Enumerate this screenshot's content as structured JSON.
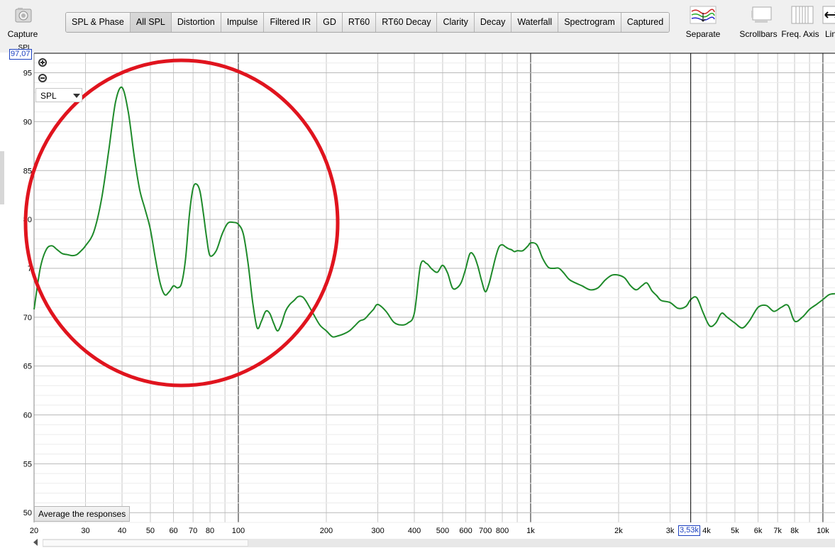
{
  "toolbar": {
    "capture_label": "Capture",
    "tabs": [
      "SPL & Phase",
      "All SPL",
      "Distortion",
      "Impulse",
      "Filtered IR",
      "GD",
      "RT60",
      "RT60 Decay",
      "Clarity",
      "Decay",
      "Waterfall",
      "Spectrogram",
      "Captured"
    ],
    "active_tab": "All SPL",
    "separate_label": "Separate",
    "scrollbars_label": "Scrollbars",
    "freq_axis_label": "Freq. Axis",
    "lin_label": "Lin"
  },
  "plot": {
    "y_axis_title": "SPL",
    "y_readout": "97,07",
    "x_readout": "3,53k",
    "spl_select_value": "SPL",
    "average_button_label": "Average the responses"
  },
  "chart_data": {
    "type": "line",
    "x_scale": "log",
    "xlim": [
      20,
      11000
    ],
    "ylim": [
      49,
      97
    ],
    "y_ticks": [
      50,
      55,
      60,
      65,
      70,
      75,
      80,
      85,
      90,
      95
    ],
    "y_tick_labels": [
      "50",
      "55",
      "60",
      "65",
      "70",
      "7",
      "80",
      "85",
      "90",
      "95"
    ],
    "x_tick_values": [
      20,
      30,
      40,
      50,
      60,
      70,
      80,
      100,
      200,
      300,
      400,
      500,
      600,
      700,
      800,
      1000,
      2000,
      3000,
      4000,
      5000,
      6000,
      7000,
      8000,
      10000
    ],
    "x_tick_labels": [
      "20",
      "30",
      "40",
      "50",
      "60",
      "70",
      "80",
      "100",
      "200",
      "300",
      "400",
      "500",
      "600",
      "700",
      "800",
      "1k",
      "2k",
      "3k",
      "4k",
      "5k",
      "6k",
      "7k",
      "8k",
      "10k"
    ],
    "cursor_x": 3530,
    "grid": true,
    "series": [
      {
        "color": "#1e8a2a",
        "x": [
          20,
          21,
          22,
          23,
          24,
          25,
          26,
          27,
          28,
          29,
          30,
          32,
          34,
          36,
          38,
          40,
          42,
          44,
          46,
          48,
          50,
          52,
          54,
          56,
          58,
          60,
          62,
          64,
          66,
          68,
          70,
          72,
          74,
          76,
          78,
          80,
          84,
          88,
          92,
          96,
          100,
          104,
          108,
          112,
          116,
          120,
          124,
          128,
          132,
          136,
          140,
          145,
          150,
          155,
          160,
          165,
          170,
          180,
          190,
          200,
          210,
          220,
          230,
          240,
          250,
          260,
          270,
          280,
          290,
          300,
          320,
          340,
          360,
          380,
          400,
          420,
          440,
          460,
          480,
          500,
          520,
          540,
          560,
          580,
          600,
          620,
          640,
          660,
          680,
          700,
          720,
          740,
          760,
          780,
          800,
          820,
          840,
          860,
          880,
          900,
          940,
          980,
          1000,
          1050,
          1100,
          1150,
          1200,
          1250,
          1300,
          1350,
          1400,
          1500,
          1600,
          1700,
          1800,
          1900,
          2000,
          2100,
          2200,
          2300,
          2400,
          2500,
          2600,
          2700,
          2800,
          3000,
          3200,
          3400,
          3530,
          3700,
          3900,
          4100,
          4300,
          4500,
          4700,
          5000,
          5300,
          5600,
          6000,
          6400,
          6800,
          7200,
          7600,
          8000,
          8500,
          9000,
          9500,
          10000,
          10500,
          11000
        ],
        "y": [
          70.8,
          75.0,
          76.9,
          77.3,
          76.9,
          76.5,
          76.4,
          76.3,
          76.4,
          76.8,
          77.3,
          78.7,
          82.0,
          87.0,
          92.0,
          93.5,
          91.0,
          86.5,
          83.0,
          81.0,
          79.0,
          76.0,
          73.5,
          72.3,
          72.6,
          73.2,
          73.0,
          73.5,
          76.0,
          80.5,
          83.2,
          83.6,
          82.8,
          80.5,
          78.0,
          76.3,
          76.8,
          78.5,
          79.6,
          79.7,
          79.5,
          78.5,
          75.5,
          71.5,
          68.9,
          69.6,
          70.6,
          70.4,
          69.4,
          68.6,
          69.2,
          70.6,
          71.3,
          71.7,
          72.1,
          72.1,
          71.7,
          70.4,
          69.2,
          68.6,
          68.0,
          68.1,
          68.3,
          68.6,
          69.1,
          69.6,
          69.8,
          70.3,
          70.8,
          71.3,
          70.6,
          69.5,
          69.2,
          69.4,
          70.4,
          75.3,
          75.5,
          74.9,
          74.6,
          75.3,
          74.5,
          73.0,
          73.0,
          73.6,
          75.0,
          76.5,
          76.3,
          75.2,
          73.7,
          72.6,
          73.4,
          74.8,
          76.2,
          77.2,
          77.4,
          77.2,
          77.0,
          76.9,
          76.7,
          76.8,
          76.8,
          77.3,
          77.6,
          77.4,
          76.0,
          75.1,
          75.0,
          75.0,
          74.5,
          73.9,
          73.6,
          73.2,
          72.8,
          73.0,
          73.8,
          74.3,
          74.3,
          74.0,
          73.2,
          72.8,
          73.2,
          73.5,
          72.7,
          72.2,
          71.7,
          71.5,
          70.9,
          71.1,
          71.8,
          72.0,
          70.4,
          69.1,
          69.4,
          70.4,
          70.0,
          69.4,
          68.9,
          69.6,
          71.0,
          71.2,
          70.6,
          71.0,
          71.2,
          69.6,
          70.0,
          70.8,
          71.3,
          71.8,
          72.3,
          72.4
        ]
      }
    ]
  }
}
